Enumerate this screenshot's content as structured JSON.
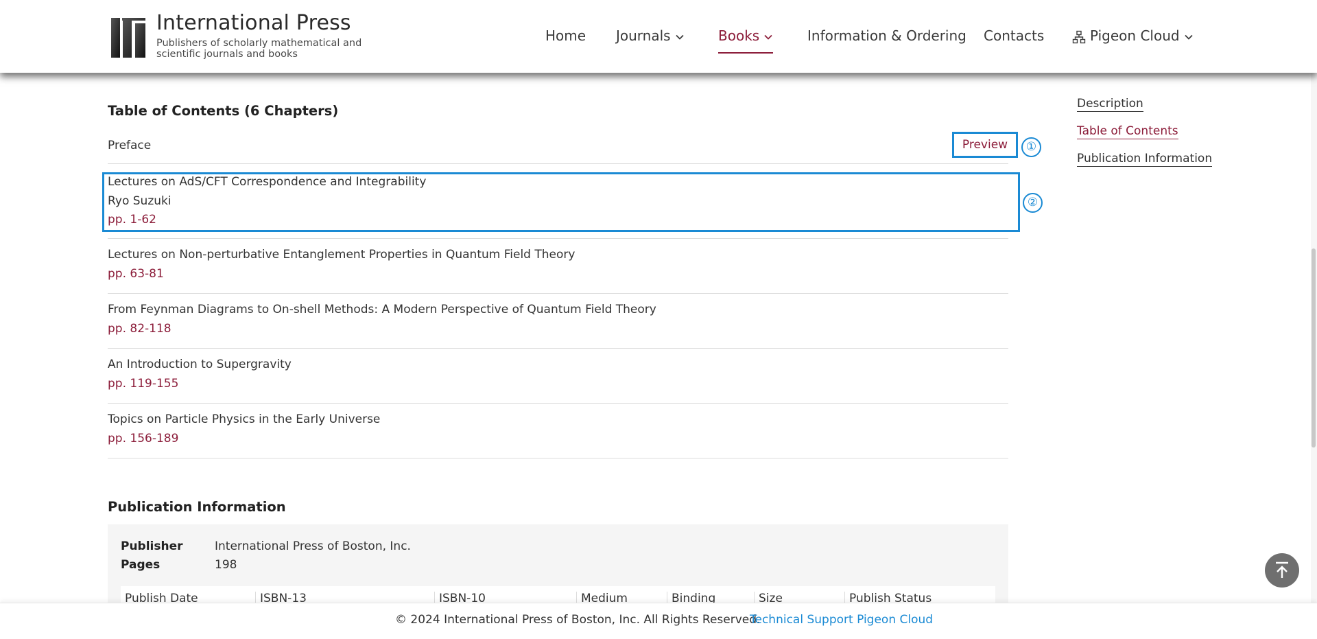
{
  "brand": {
    "name": "International Press",
    "tagline": "Publishers of scholarly mathematical and scientific journals and books"
  },
  "nav": {
    "home": "Home",
    "journals": "Journals",
    "books": "Books",
    "info_ordering": "Information & Ordering",
    "contacts": "Contacts",
    "pigeon_cloud": "Pigeon Cloud"
  },
  "toc": {
    "title": "Table of Contents (6 Chapters)",
    "preface": "Preface",
    "preview_label": "Preview",
    "chapters": [
      {
        "title": "Lectures on AdS/CFT Correspondence and Integrability",
        "author": "Ryo Suzuki",
        "pages": "pp. 1-62"
      },
      {
        "title": "Lectures on Non-perturbative Entanglement Properties in Quantum Field Theory",
        "pages": "pp. 63-81"
      },
      {
        "title": "From Feynman Diagrams to On-shell Methods: A Modern Perspective of Quantum Field Theory",
        "pages": "pp. 82-118"
      },
      {
        "title": "An Introduction to Supergravity",
        "pages": "pp. 119-155"
      },
      {
        "title": "Topics on Particle Physics in the Early Universe",
        "pages": "pp. 156-189"
      }
    ]
  },
  "markers": {
    "one": "①",
    "two": "②"
  },
  "sidebar": {
    "description": "Description",
    "table_of_contents": "Table of Contents",
    "publication_information": "Publication Information"
  },
  "publication": {
    "title": "Publication Information",
    "publisher_label": "Publisher",
    "publisher_value": "International Press of Boston, Inc.",
    "pages_label": "Pages",
    "pages_value": "198",
    "table_headers": [
      "Publish Date",
      "ISBN-13",
      "ISBN-10",
      "Medium",
      "Binding",
      "Size",
      "Publish Status"
    ]
  },
  "footer": {
    "copyright": "© 2024 International Press of Boston, Inc. All Rights Reserved.",
    "support": "Technical Support Pigeon Cloud"
  },
  "colors": {
    "accent": "#8c1d3a",
    "annotation_blue": "#1a8ad4",
    "panel_bg": "#f5f5f5",
    "scroll_top_bg": "#6f6f6f"
  },
  "icons": {
    "logo": "ip-logo",
    "chevron": "chevron-down-icon",
    "cloud": "sitemap-icon",
    "to_top": "arrow-up-to-line-icon"
  }
}
